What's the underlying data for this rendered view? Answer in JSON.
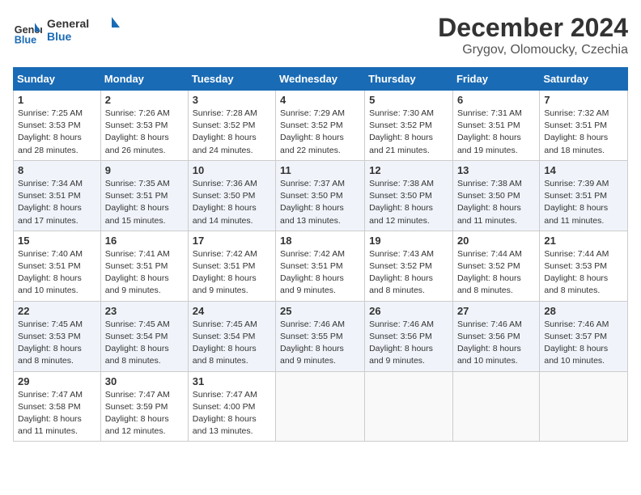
{
  "logo": {
    "text_general": "General",
    "text_blue": "Blue"
  },
  "title": "December 2024",
  "subtitle": "Grygov, Olomoucky, Czechia",
  "days_of_week": [
    "Sunday",
    "Monday",
    "Tuesday",
    "Wednesday",
    "Thursday",
    "Friday",
    "Saturday"
  ],
  "weeks": [
    [
      {
        "day": "1",
        "sunrise": "7:25 AM",
        "sunset": "3:53 PM",
        "daylight": "8 hours and 28 minutes."
      },
      {
        "day": "2",
        "sunrise": "7:26 AM",
        "sunset": "3:53 PM",
        "daylight": "8 hours and 26 minutes."
      },
      {
        "day": "3",
        "sunrise": "7:28 AM",
        "sunset": "3:52 PM",
        "daylight": "8 hours and 24 minutes."
      },
      {
        "day": "4",
        "sunrise": "7:29 AM",
        "sunset": "3:52 PM",
        "daylight": "8 hours and 22 minutes."
      },
      {
        "day": "5",
        "sunrise": "7:30 AM",
        "sunset": "3:52 PM",
        "daylight": "8 hours and 21 minutes."
      },
      {
        "day": "6",
        "sunrise": "7:31 AM",
        "sunset": "3:51 PM",
        "daylight": "8 hours and 19 minutes."
      },
      {
        "day": "7",
        "sunrise": "7:32 AM",
        "sunset": "3:51 PM",
        "daylight": "8 hours and 18 minutes."
      }
    ],
    [
      {
        "day": "8",
        "sunrise": "7:34 AM",
        "sunset": "3:51 PM",
        "daylight": "8 hours and 17 minutes."
      },
      {
        "day": "9",
        "sunrise": "7:35 AM",
        "sunset": "3:51 PM",
        "daylight": "8 hours and 15 minutes."
      },
      {
        "day": "10",
        "sunrise": "7:36 AM",
        "sunset": "3:50 PM",
        "daylight": "8 hours and 14 minutes."
      },
      {
        "day": "11",
        "sunrise": "7:37 AM",
        "sunset": "3:50 PM",
        "daylight": "8 hours and 13 minutes."
      },
      {
        "day": "12",
        "sunrise": "7:38 AM",
        "sunset": "3:50 PM",
        "daylight": "8 hours and 12 minutes."
      },
      {
        "day": "13",
        "sunrise": "7:38 AM",
        "sunset": "3:50 PM",
        "daylight": "8 hours and 11 minutes."
      },
      {
        "day": "14",
        "sunrise": "7:39 AM",
        "sunset": "3:51 PM",
        "daylight": "8 hours and 11 minutes."
      }
    ],
    [
      {
        "day": "15",
        "sunrise": "7:40 AM",
        "sunset": "3:51 PM",
        "daylight": "8 hours and 10 minutes."
      },
      {
        "day": "16",
        "sunrise": "7:41 AM",
        "sunset": "3:51 PM",
        "daylight": "8 hours and 9 minutes."
      },
      {
        "day": "17",
        "sunrise": "7:42 AM",
        "sunset": "3:51 PM",
        "daylight": "8 hours and 9 minutes."
      },
      {
        "day": "18",
        "sunrise": "7:42 AM",
        "sunset": "3:51 PM",
        "daylight": "8 hours and 9 minutes."
      },
      {
        "day": "19",
        "sunrise": "7:43 AM",
        "sunset": "3:52 PM",
        "daylight": "8 hours and 8 minutes."
      },
      {
        "day": "20",
        "sunrise": "7:44 AM",
        "sunset": "3:52 PM",
        "daylight": "8 hours and 8 minutes."
      },
      {
        "day": "21",
        "sunrise": "7:44 AM",
        "sunset": "3:53 PM",
        "daylight": "8 hours and 8 minutes."
      }
    ],
    [
      {
        "day": "22",
        "sunrise": "7:45 AM",
        "sunset": "3:53 PM",
        "daylight": "8 hours and 8 minutes."
      },
      {
        "day": "23",
        "sunrise": "7:45 AM",
        "sunset": "3:54 PM",
        "daylight": "8 hours and 8 minutes."
      },
      {
        "day": "24",
        "sunrise": "7:45 AM",
        "sunset": "3:54 PM",
        "daylight": "8 hours and 8 minutes."
      },
      {
        "day": "25",
        "sunrise": "7:46 AM",
        "sunset": "3:55 PM",
        "daylight": "8 hours and 9 minutes."
      },
      {
        "day": "26",
        "sunrise": "7:46 AM",
        "sunset": "3:56 PM",
        "daylight": "8 hours and 9 minutes."
      },
      {
        "day": "27",
        "sunrise": "7:46 AM",
        "sunset": "3:56 PM",
        "daylight": "8 hours and 10 minutes."
      },
      {
        "day": "28",
        "sunrise": "7:46 AM",
        "sunset": "3:57 PM",
        "daylight": "8 hours and 10 minutes."
      }
    ],
    [
      {
        "day": "29",
        "sunrise": "7:47 AM",
        "sunset": "3:58 PM",
        "daylight": "8 hours and 11 minutes."
      },
      {
        "day": "30",
        "sunrise": "7:47 AM",
        "sunset": "3:59 PM",
        "daylight": "8 hours and 12 minutes."
      },
      {
        "day": "31",
        "sunrise": "7:47 AM",
        "sunset": "4:00 PM",
        "daylight": "8 hours and 13 minutes."
      },
      null,
      null,
      null,
      null
    ]
  ]
}
